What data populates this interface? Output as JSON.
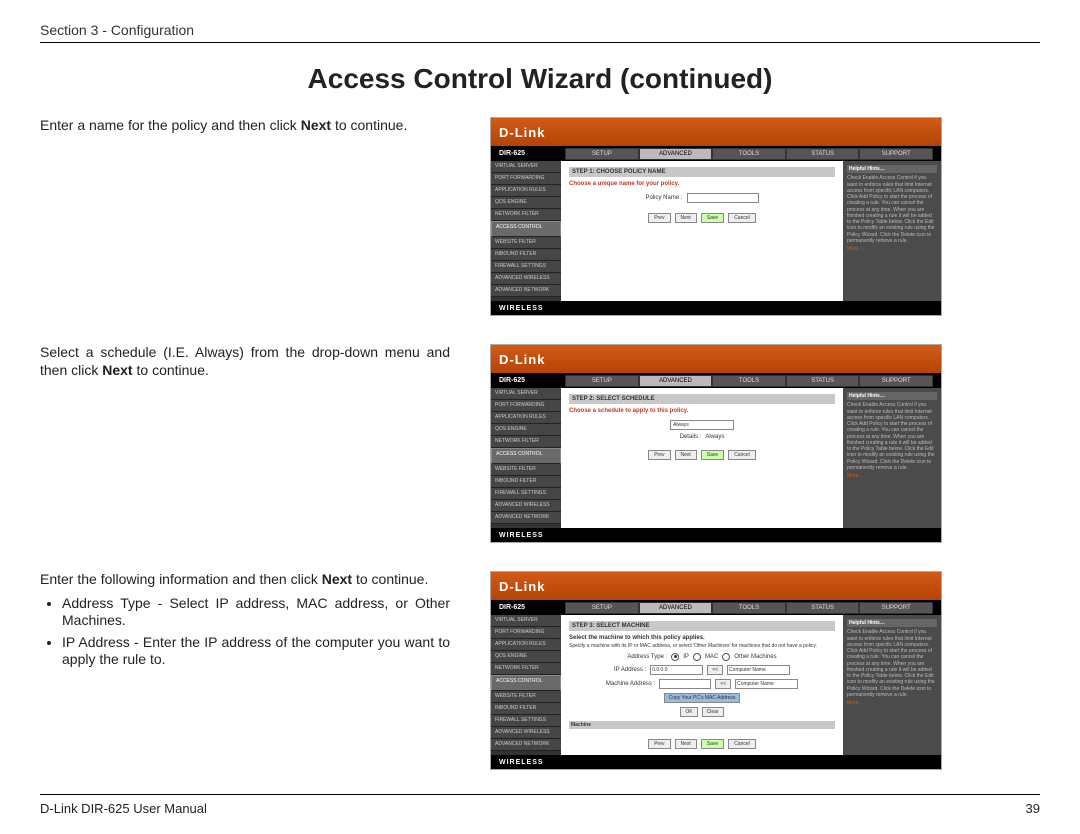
{
  "header": {
    "section": "Section 3 - Configuration"
  },
  "title": "Access Control Wizard (continued)",
  "footer": {
    "manual": "D-Link DIR-625 User Manual",
    "page": "39"
  },
  "step1": {
    "intro_before": "Enter a name for the policy and then click ",
    "intro_bold": "Next",
    "intro_after": " to continue.",
    "shot": {
      "brand": "D-Link",
      "product": "DIR-625",
      "tabs": [
        "SETUP",
        "ADVANCED",
        "TOOLS",
        "STATUS",
        "SUPPORT"
      ],
      "active_tab": 1,
      "sidenav": [
        "VIRTUAL SERVER",
        "PORT FORWARDING",
        "APPLICATION RULES",
        "QOS ENGINE",
        "NETWORK FILTER",
        "ACCESS CONTROL",
        "WEBSITE FILTER",
        "INBOUND FILTER",
        "FIREWALL SETTINGS",
        "ADVANCED WIRELESS",
        "ADVANCED NETWORK"
      ],
      "selected_nav": 5,
      "stepbar": "STEP 1: CHOOSE POLICY NAME",
      "instruction": "Choose a unique name for your policy.",
      "field_label": "Policy Name :",
      "buttons": [
        "Prev",
        "Next",
        "Save",
        "Cancel"
      ],
      "hints_title": "Helpful Hints…",
      "hints": "Check Enable Access Control if you want to enforce rules that limit Internet access from specific LAN computers. Click Add Policy to start the process of creating a rule. You can cancel the process at any time. When you are finished creating a rule it will be added to the Policy Table below. Click the Edit icon to modify an existing rule using the Policy Wizard. Click the Delete icon to permanently remove a rule.",
      "hints_more": "More…",
      "footer": "WIRELESS"
    }
  },
  "step2": {
    "intro_before": "Select a schedule (I.E. Always) from the drop-down menu and then click ",
    "intro_bold": "Next",
    "intro_after": " to continue.",
    "shot": {
      "brand": "D-Link",
      "product": "DIR-625",
      "tabs": [
        "SETUP",
        "ADVANCED",
        "TOOLS",
        "STATUS",
        "SUPPORT"
      ],
      "active_tab": 1,
      "sidenav": [
        "VIRTUAL SERVER",
        "PORT FORWARDING",
        "APPLICATION RULES",
        "QOS ENGINE",
        "NETWORK FILTER",
        "ACCESS CONTROL",
        "WEBSITE FILTER",
        "INBOUND FILTER",
        "FIREWALL SETTINGS",
        "ADVANCED WIRELESS",
        "ADVANCED NETWORK"
      ],
      "selected_nav": 5,
      "stepbar": "STEP 2: SELECT SCHEDULE",
      "instruction": "Choose a schedule to apply to this policy.",
      "select_value": "Always",
      "details_label": "Details :",
      "details_value": "Always",
      "buttons": [
        "Prev",
        "Next",
        "Save",
        "Cancel"
      ],
      "hints_title": "Helpful Hints…",
      "hints": "Check Enable Access Control if you want to enforce rules that limit Internet access from specific LAN computers. Click Add Policy to start the process of creating a rule. You can cancel the process at any time. When you are finished creating a rule it will be added to the Policy Table below. Click the Edit icon to modify an existing rule using the Policy Wizard. Click the Delete icon to permanently remove a rule.",
      "hints_more": "More…",
      "footer": "WIRELESS"
    }
  },
  "step3": {
    "intro_before": "Enter the following information and then click ",
    "intro_bold": "Next",
    "intro_after": " to continue.",
    "bullets": [
      "Address Type - Select IP address, MAC address, or Other Machines.",
      "IP Address - Enter the IP address of the computer you want to apply the rule to."
    ],
    "shot": {
      "brand": "D-Link",
      "product": "DIR-625",
      "tabs": [
        "SETUP",
        "ADVANCED",
        "TOOLS",
        "STATUS",
        "SUPPORT"
      ],
      "active_tab": 1,
      "sidenav": [
        "VIRTUAL SERVER",
        "PORT FORWARDING",
        "APPLICATION RULES",
        "QOS ENGINE",
        "NETWORK FILTER",
        "ACCESS CONTROL",
        "WEBSITE FILTER",
        "INBOUND FILTER",
        "FIREWALL SETTINGS",
        "ADVANCED WIRELESS",
        "ADVANCED NETWORK"
      ],
      "selected_nav": 5,
      "stepbar": "STEP 3: SELECT MACHINE",
      "subtitle": "Select the machine to which this policy applies.",
      "instruction": "Specify a machine with its IP or MAC address, or select 'Other Machines' for machines that do not have a policy.",
      "addr_label": "Address Type :",
      "addr_opts": [
        "IP",
        "MAC",
        "Other Machines"
      ],
      "ip_label": "IP Address :",
      "ip_value": "0.0.0.0",
      "ip_copy_btn": "<<",
      "ip_select": "Computer Name",
      "mac_label": "Machine Address :",
      "mac_copy_btn": "<<",
      "mac_select": "Computer Name",
      "clone_btn": "Copy Your PC's MAC Address",
      "ok_btn": "OK",
      "clear_btn": "Clear",
      "table_header": "Machine",
      "buttons": [
        "Prev",
        "Next",
        "Save",
        "Cancel"
      ],
      "hints_title": "Helpful Hints…",
      "hints": "Check Enable Access Control if you want to enforce rules that limit Internet access from specific LAN computers. Click Add Policy to start the process of creating a rule. You can cancel the process at any time. When you are finished creating a rule it will be added to the Policy Table below. Click the Edit icon to modify an existing rule using the Policy Wizard. Click the Delete icon to permanently remove a rule.",
      "hints_more": "More…",
      "footer": "WIRELESS"
    }
  }
}
